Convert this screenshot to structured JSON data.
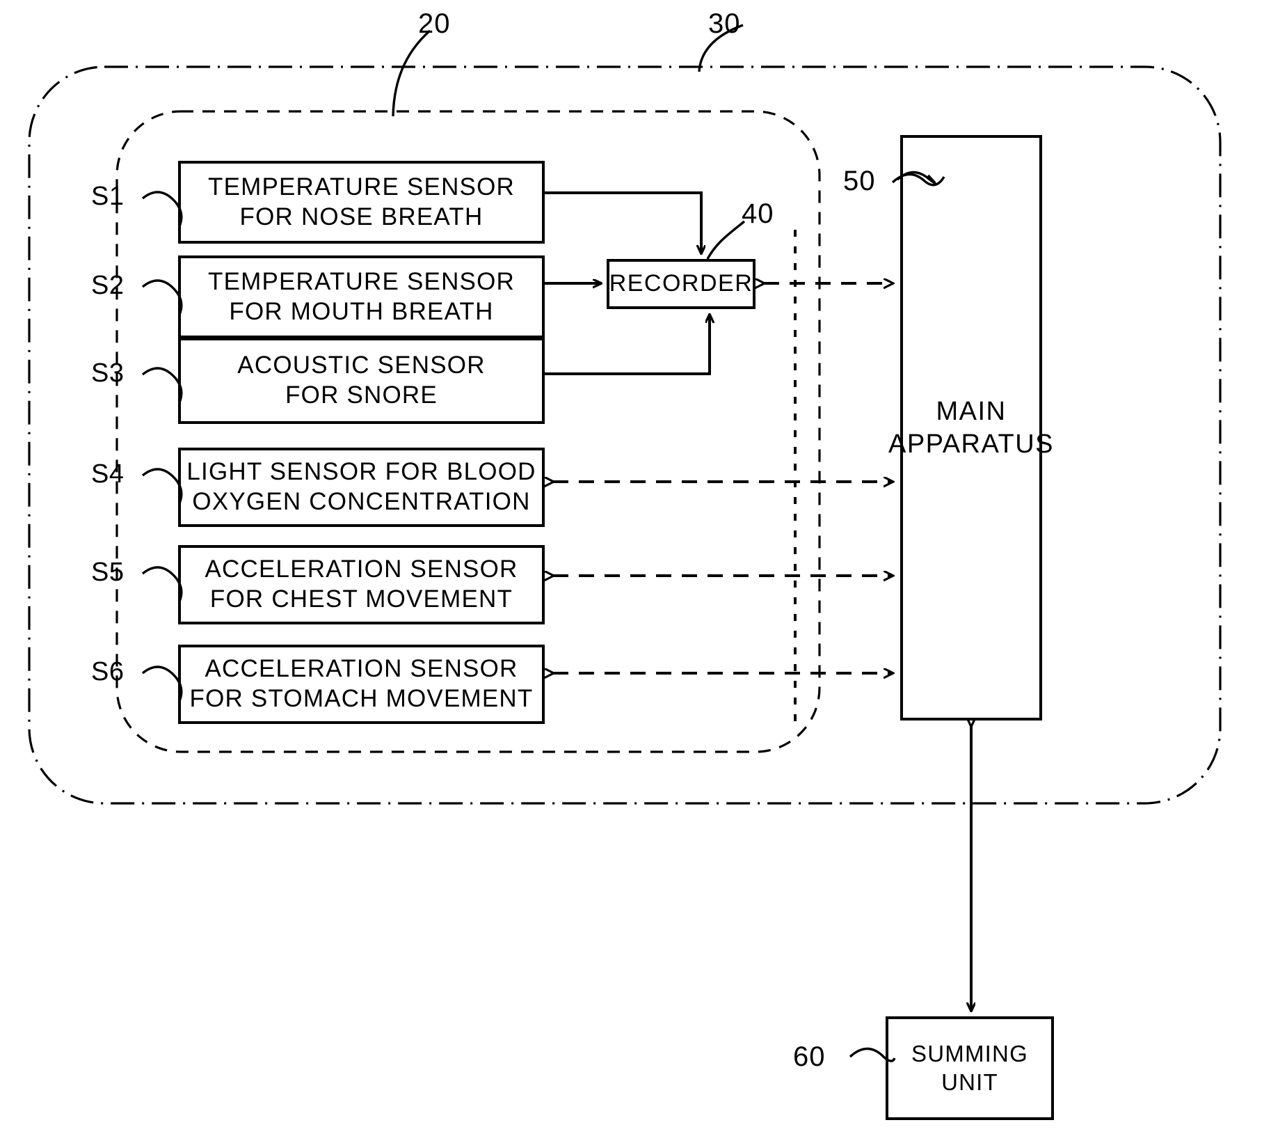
{
  "figure": {
    "type": "patent-block-diagram",
    "background_color": "#ffffff",
    "line_color": "#000000"
  },
  "reference_numerals": {
    "inner_enclosure": "20",
    "outer_enclosure": "30",
    "recorder": "40",
    "main_apparatus": "50",
    "summing_unit": "60"
  },
  "sensors": [
    {
      "tag": "S1",
      "line1": "TEMPERATURE SENSOR",
      "line2": "FOR NOSE BREATH"
    },
    {
      "tag": "S2",
      "line1": "TEMPERATURE SENSOR",
      "line2": "FOR MOUTH BREATH"
    },
    {
      "tag": "S3",
      "line1": "ACOUSTIC SENSOR",
      "line2": "FOR SNORE"
    },
    {
      "tag": "S4",
      "line1": "LIGHT SENSOR FOR BLOOD",
      "line2": "OXYGEN CONCENTRATION"
    },
    {
      "tag": "S5",
      "line1": "ACCELERATION SENSOR",
      "line2": "FOR CHEST MOVEMENT"
    },
    {
      "tag": "S6",
      "line1": "ACCELERATION SENSOR",
      "line2": "FOR STOMACH MOVEMENT"
    }
  ],
  "blocks": {
    "recorder": {
      "label": "RECORDER"
    },
    "main_apparatus": {
      "line1": "MAIN",
      "line2": "APPARATUS"
    },
    "summing_unit": {
      "line1": "SUMMING",
      "line2": "UNIT"
    }
  }
}
